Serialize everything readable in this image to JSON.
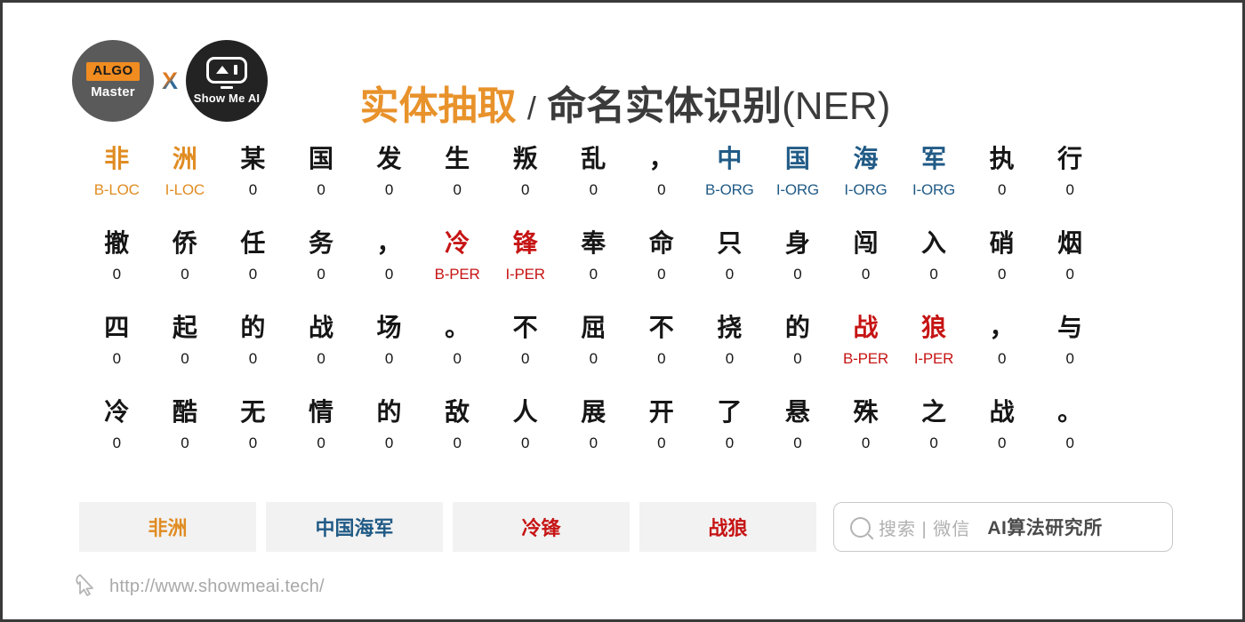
{
  "brand": {
    "logo_left_top": "ALGO",
    "logo_left_bottom": "Master",
    "logo_separator": "X",
    "logo_right_text": "Show Me AI"
  },
  "header": {
    "title_orange": "实体抽取",
    "title_separator": "/",
    "title_dark": "命名实体识别",
    "title_suffix": "(NER)"
  },
  "colors": {
    "loc": "#e08c22",
    "org": "#215b86",
    "per": "#c61414",
    "plain": "#161616",
    "chip_bg": "#f2f2f2",
    "title_dark": "#3b3b3b"
  },
  "grid": {
    "rows": [
      {
        "chars": [
          "非",
          "洲",
          "某",
          "国",
          "发",
          "生",
          "叛",
          "乱",
          "，",
          "中",
          "国",
          "海",
          "军",
          "执",
          "行"
        ],
        "char_types": [
          "loc",
          "loc",
          "plain",
          "plain",
          "plain",
          "plain",
          "plain",
          "plain",
          "plain",
          "org",
          "org",
          "org",
          "org",
          "plain",
          "plain"
        ],
        "tags": [
          "B-LOC",
          "I-LOC",
          "0",
          "0",
          "0",
          "0",
          "0",
          "0",
          "0",
          "B-ORG",
          "I-ORG",
          "I-ORG",
          "I-ORG",
          "0",
          "0"
        ],
        "tag_types": [
          "loc",
          "loc",
          "o",
          "o",
          "o",
          "o",
          "o",
          "o",
          "o",
          "org",
          "org",
          "org",
          "org",
          "o",
          "o"
        ]
      },
      {
        "chars": [
          "撤",
          "侨",
          "任",
          "务",
          "，",
          "冷",
          "锋",
          "奉",
          "命",
          "只",
          "身",
          "闯",
          "入",
          "硝",
          "烟"
        ],
        "char_types": [
          "plain",
          "plain",
          "plain",
          "plain",
          "plain",
          "per",
          "per",
          "plain",
          "plain",
          "plain",
          "plain",
          "plain",
          "plain",
          "plain",
          "plain"
        ],
        "tags": [
          "0",
          "0",
          "0",
          "0",
          "0",
          "B-PER",
          "I-PER",
          "0",
          "0",
          "0",
          "0",
          "0",
          "0",
          "0",
          "0"
        ],
        "tag_types": [
          "o",
          "o",
          "o",
          "o",
          "o",
          "per",
          "per",
          "o",
          "o",
          "o",
          "o",
          "o",
          "o",
          "o",
          "o"
        ]
      },
      {
        "chars": [
          "四",
          "起",
          "的",
          "战",
          "场",
          "。",
          "不",
          "屈",
          "不",
          "挠",
          "的",
          "战",
          "狼",
          "，",
          "与"
        ],
        "char_types": [
          "plain",
          "plain",
          "plain",
          "plain",
          "plain",
          "plain",
          "plain",
          "plain",
          "plain",
          "plain",
          "plain",
          "per",
          "per",
          "plain",
          "plain"
        ],
        "tags": [
          "0",
          "0",
          "0",
          "0",
          "0",
          "0",
          "0",
          "0",
          "0",
          "0",
          "0",
          "B-PER",
          "I-PER",
          "0",
          "0"
        ],
        "tag_types": [
          "o",
          "o",
          "o",
          "o",
          "o",
          "o",
          "o",
          "o",
          "o",
          "o",
          "o",
          "per",
          "per",
          "o",
          "o"
        ]
      },
      {
        "chars": [
          "冷",
          "酷",
          "无",
          "情",
          "的",
          "敌",
          "人",
          "展",
          "开",
          "了",
          "悬",
          "殊",
          "之",
          "战",
          "。"
        ],
        "char_types": [
          "plain",
          "plain",
          "plain",
          "plain",
          "plain",
          "plain",
          "plain",
          "plain",
          "plain",
          "plain",
          "plain",
          "plain",
          "plain",
          "plain",
          "plain"
        ],
        "tags": [
          "0",
          "0",
          "0",
          "0",
          "0",
          "0",
          "0",
          "0",
          "0",
          "0",
          "0",
          "0",
          "0",
          "0",
          "0"
        ],
        "tag_types": [
          "o",
          "o",
          "o",
          "o",
          "o",
          "o",
          "o",
          "o",
          "o",
          "o",
          "o",
          "o",
          "o",
          "o",
          "o"
        ]
      }
    ]
  },
  "entities": [
    {
      "text": "非洲",
      "type": "loc"
    },
    {
      "text": "中国海军",
      "type": "org"
    },
    {
      "text": "冷锋",
      "type": "per"
    },
    {
      "text": "战狼",
      "type": "per"
    }
  ],
  "search": {
    "hint": "搜索 | 微信",
    "brand": "AI算法研究所"
  },
  "footer": {
    "url": "http://www.showmeai.tech/"
  }
}
